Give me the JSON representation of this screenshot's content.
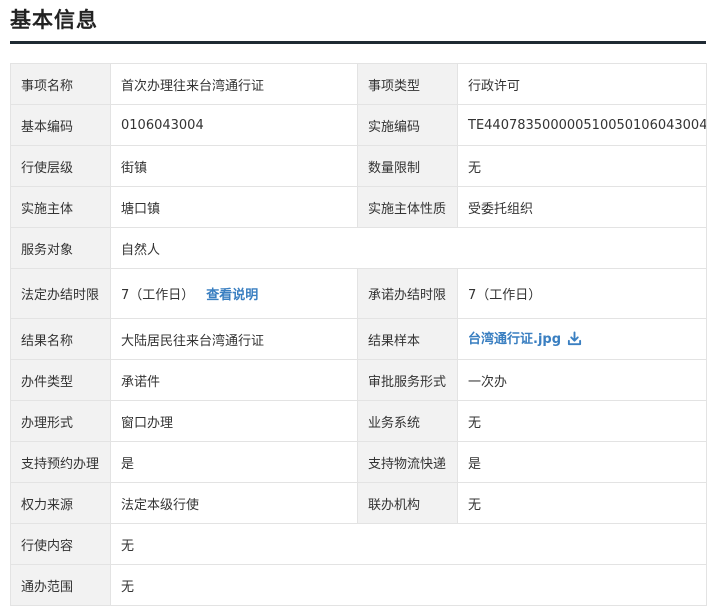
{
  "page": {
    "title": "基本信息"
  },
  "rows": {
    "r1": {
      "l1": "事项名称",
      "v1": "首次办理往来台湾通行证",
      "l2": "事项类型",
      "v2": "行政许可"
    },
    "r2": {
      "l1": "基本编码",
      "v1": "0106043004",
      "l2": "实施编码",
      "v2": "TE440783500000510050106043004"
    },
    "r3": {
      "l1": "行使层级",
      "v1": "街镇",
      "l2": "数量限制",
      "v2": "无"
    },
    "r4": {
      "l1": "实施主体",
      "v1": "塘口镇",
      "l2": "实施主体性质",
      "v2": "受委托组织"
    },
    "r5": {
      "l1": "服务对象",
      "v1": "自然人"
    },
    "r6": {
      "l1": "法定办结时限",
      "v1": "7（工作日）",
      "link": "查看说明",
      "l2": "承诺办结时限",
      "v2": "7（工作日）"
    },
    "r7": {
      "l1": "结果名称",
      "v1": "大陆居民往来台湾通行证",
      "l2": "结果样本",
      "v2": "台湾通行证.jpg"
    },
    "r8": {
      "l1": "办件类型",
      "v1": "承诺件",
      "l2": "审批服务形式",
      "v2": "一次办"
    },
    "r9": {
      "l1": "办理形式",
      "v1": "窗口办理",
      "l2": "业务系统",
      "v2": "无"
    },
    "r10": {
      "l1": "支持预约办理",
      "v1": "是",
      "l2": "支持物流快递",
      "v2": "是"
    },
    "r11": {
      "l1": "权力来源",
      "v1": "法定本级行使",
      "l2": "联办机构",
      "v2": "无"
    },
    "r12": {
      "l1": "行使内容",
      "v1": "无"
    },
    "r13": {
      "l1": "通办范围",
      "v1": "无"
    }
  },
  "colors": {
    "link": "#3a7fc1",
    "label_bg": "#f2f2f2",
    "border": "#e3e3e3",
    "title_rule": "#1f2a33"
  },
  "icons": {
    "result_sample": "download-icon"
  }
}
